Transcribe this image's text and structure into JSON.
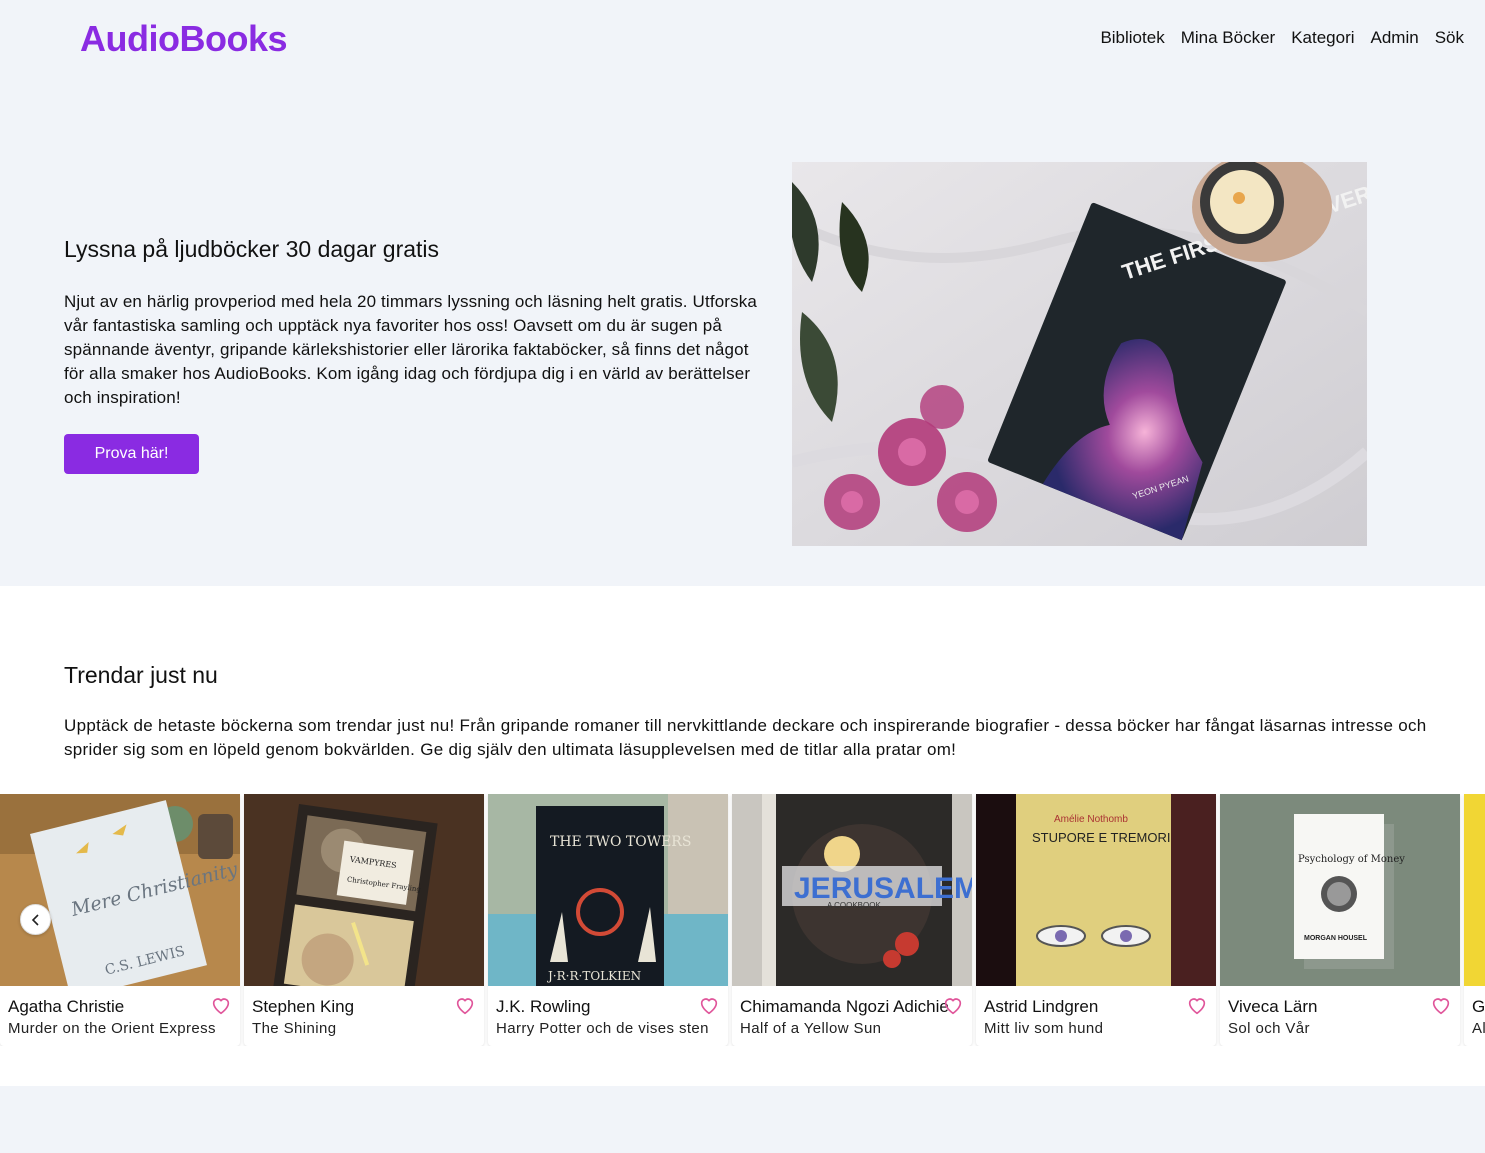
{
  "header": {
    "logo": "AudioBooks",
    "nav": [
      "Bibliotek",
      "Mina Böcker",
      "Kategori",
      "Admin",
      "Sök"
    ]
  },
  "hero": {
    "title": "Lyssna på ljudböcker 30 dagar gratis",
    "text": "Njut av en härlig provperiod med hela 20 timmars lyssning och läsning helt gratis. Utforska vår fantastiska samling och upptäck nya favoriter hos oss! Oavsett om du är sugen på spännande äventyr, gripande kärlekshistorier eller lärorika faktaböcker, så finns det något för alla smaker hos AudioBooks. Kom igång idag och fördjupa dig i en värld av berättelser och inspiration!",
    "cta": "Prova här!",
    "image_book_text": "THE FIRST NEW UNIVERSE",
    "image_author_text": "YEON PYEAN"
  },
  "trending": {
    "title": "Trendar just nu",
    "text": "Upptäck de hetaste böckerna som trendar just nu! Från gripande romaner till nervkittlande deckare och inspirerande biografier - dessa böcker har fångat läsarnas intresse och sprider sig som en löpeld genom bokvärlden. Ge dig själv den ultimata läsupplevelsen med de titlar alla pratar om!",
    "books": [
      {
        "author": "Agatha Christie",
        "title": "Murder on the Orient Express",
        "cover_text": "Mere Christianity",
        "cover_sub": "C.S. LEWIS"
      },
      {
        "author": "Stephen King",
        "title": "The Shining",
        "cover_text": "VAMPYRES",
        "cover_sub": "Christopher Frayling"
      },
      {
        "author": "J.K. Rowling",
        "title": "Harry Potter och de vises sten",
        "cover_text": "THE TWO TOWERS",
        "cover_sub": "J·R·R·TOLKIEN"
      },
      {
        "author": "Chimamanda Ngozi Adichie",
        "title": "Half of a Yellow Sun",
        "cover_text": "JERUSALEM",
        "cover_sub": "A COOKBOOK"
      },
      {
        "author": "Astrid Lindgren",
        "title": "Mitt liv som hund",
        "cover_text": "STUPORE E TREMORI",
        "cover_sub": "Amélie Nothomb"
      },
      {
        "author": "Viveca Lärn",
        "title": "Sol och Vår",
        "cover_text": "Psychology of Money",
        "cover_sub": "MORGAN HOUSEL"
      },
      {
        "author": "Gl",
        "title": "Al",
        "cover_text": "",
        "cover_sub": ""
      }
    ]
  },
  "colors": {
    "accent": "#8a2be2",
    "heart": "#e0559a",
    "page_bg": "#f1f4f9"
  }
}
